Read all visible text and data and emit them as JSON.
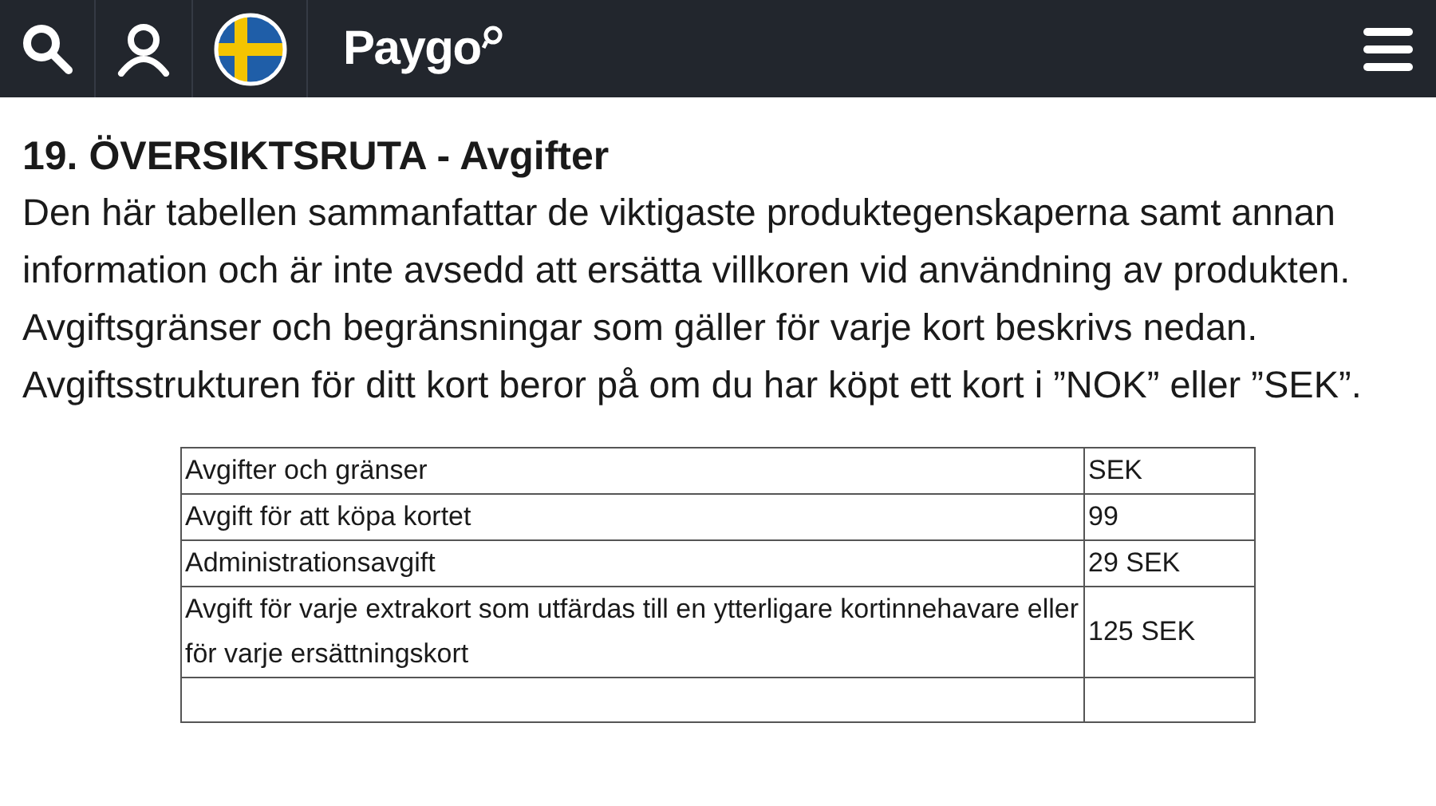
{
  "header": {
    "brand": "Paygo"
  },
  "heading": "19. ÖVERSIKTSRUTA - Avgifter",
  "paragraphs": [
    "Den här tabellen sammanfattar de viktigaste produktegenskaperna samt annan information och är inte avsedd att ersätta villkoren vid användning av produkten. Avgiftsgränser och begränsningar som gäller för varje kort beskrivs nedan.",
    "Avgiftsstrukturen för ditt kort beror på om du har köpt ett kort i ”NOK” eller ”SEK”."
  ],
  "table": {
    "rows": [
      {
        "label": "Avgifter och gränser",
        "value": "SEK"
      },
      {
        "label": "Avgift för att köpa kortet",
        "value": "99"
      },
      {
        "label": "Administrationsavgift",
        "value": "29 SEK"
      },
      {
        "label": "Avgift för varje extrakort som utfärdas till en ytterligare kortinnehavare eller för varje ersättningskort",
        "value": "125 SEK"
      }
    ]
  }
}
